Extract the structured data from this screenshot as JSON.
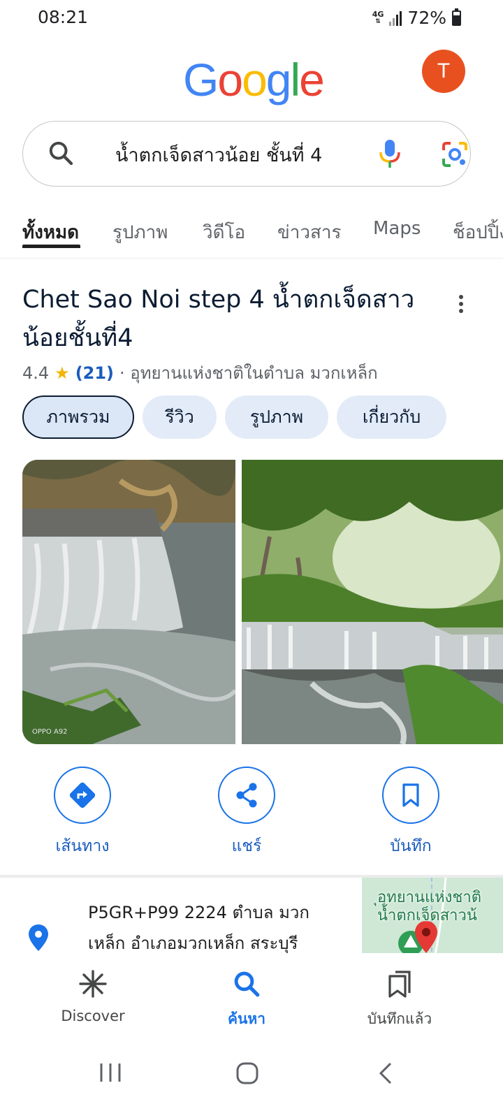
{
  "status_bar": {
    "time": "08:21",
    "network": "4G",
    "battery": "72%",
    "battery_level": 0.72
  },
  "header": {
    "logo_letters": [
      "G",
      "o",
      "o",
      "g",
      "l",
      "e"
    ],
    "logo_colors": [
      "#4285F4",
      "#EA4335",
      "#FBBC05",
      "#4285F4",
      "#34A853",
      "#EA4335"
    ],
    "avatar_letter": "T",
    "avatar_color": "#e8511f"
  },
  "search": {
    "query": "น้ำตกเจ็ดสาวน้อย ชั้นที่ 4",
    "icon": "search-icon"
  },
  "tabs": [
    {
      "label": "ทั้งหมด",
      "active": true
    },
    {
      "label": "รูปภาพ",
      "active": false
    },
    {
      "label": "วิดีโอ",
      "active": false
    },
    {
      "label": "ข่าวสาร",
      "active": false
    },
    {
      "label": "Maps",
      "active": false
    },
    {
      "label": "ช็อปปิ้ง",
      "active": false
    }
  ],
  "place": {
    "title": "Chet Sao Noi step 4 น้ำตกเจ็ดสาวน้อยชั้นที่4",
    "rating": "4.4",
    "review_count": "(21)",
    "category": "· อุทยานแห่งชาติในตำบล มวกเหล็ก"
  },
  "chips": [
    {
      "label": "ภาพรวม",
      "selected": true
    },
    {
      "label": "รีวิว",
      "selected": false
    },
    {
      "label": "รูปภาพ",
      "selected": false
    },
    {
      "label": "เกี่ยวกับ",
      "selected": false
    }
  ],
  "photos": {
    "watermark": "OPPO A92"
  },
  "actions": [
    {
      "label": "เส้นทาง",
      "icon": "directions-icon"
    },
    {
      "label": "แชร์",
      "icon": "share-icon"
    },
    {
      "label": "บันทึก",
      "icon": "bookmark-icon"
    }
  ],
  "address": {
    "text": "P5GR+P99 2224 ตำบล มวกเหล็ก อำเภอมวกเหล็ก สระบุรี",
    "map_label_1": "ุอุทยานแห่งชาติ",
    "map_label_2": "น้ำตกเจ็ดสาวน้"
  },
  "bottom_nav": [
    {
      "label": "Discover",
      "icon": "asterisk-icon",
      "active": false
    },
    {
      "label": "ค้นหา",
      "icon": "search-icon",
      "active": true
    },
    {
      "label": "บันทึกแล้ว",
      "icon": "saved-icon",
      "active": false
    }
  ],
  "accent_color": "#1a73e8"
}
